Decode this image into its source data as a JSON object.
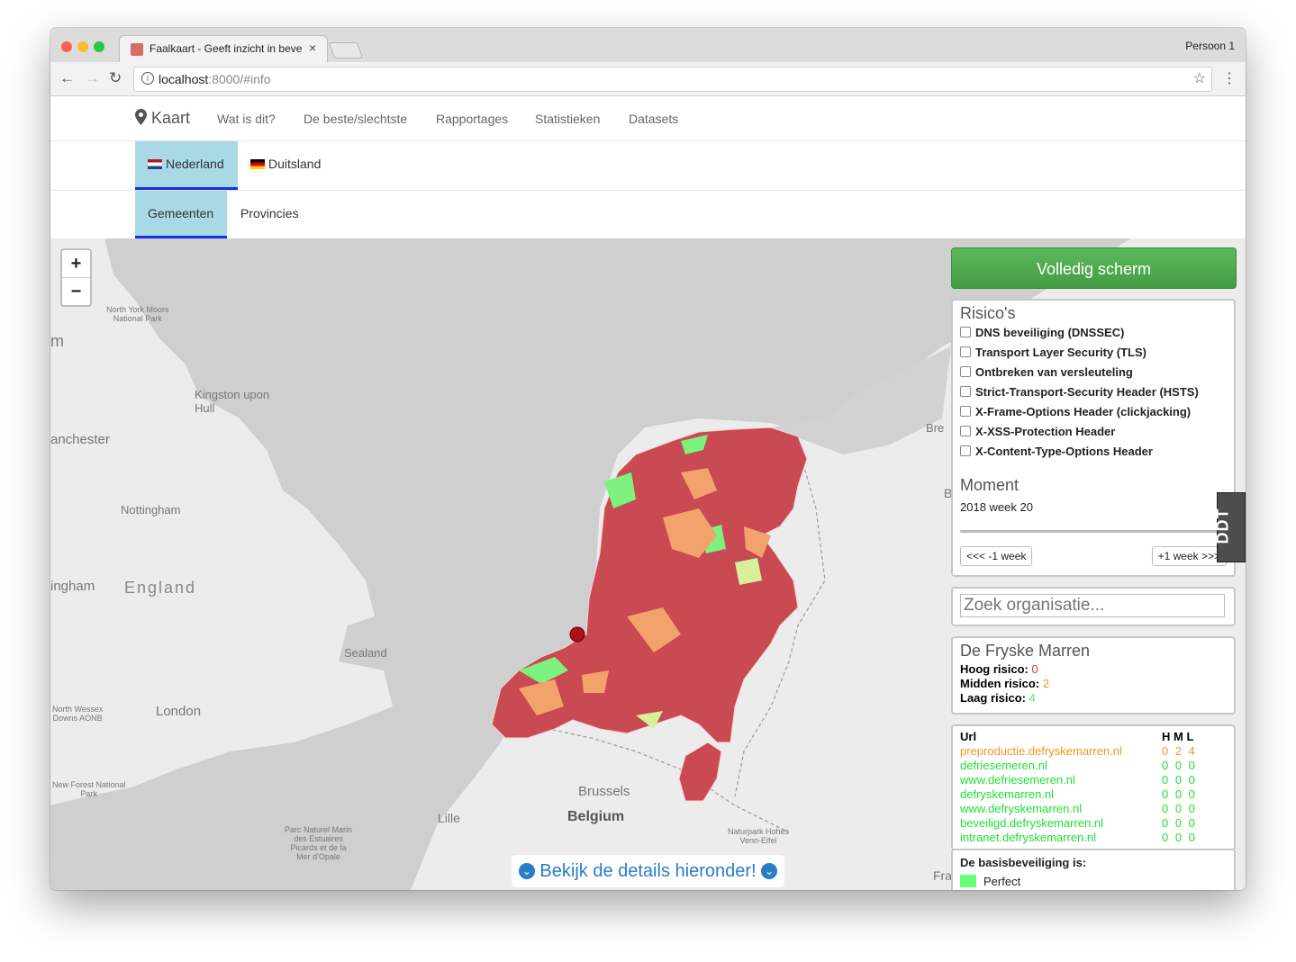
{
  "browser": {
    "tab_title": "Faalkaart - Geeft inzicht in beveiliging",
    "profile": "Persoon 1",
    "url_host": "localhost",
    "url_rest": ":8000/#info",
    "back": "←",
    "forward": "→",
    "reload": "↻",
    "info": "i",
    "star": "☆",
    "menu": "⋮",
    "close": "×"
  },
  "nav": {
    "brand": "Kaart",
    "links": [
      "Wat is dit?",
      "De beste/slechtste",
      "Rapportages",
      "Statistieken",
      "Datasets"
    ]
  },
  "countries": [
    "Nederland",
    "Duitsland"
  ],
  "layers": [
    "Gemeenten",
    "Provincies"
  ],
  "map": {
    "zoom_in": "+",
    "zoom_out": "−",
    "labels": {
      "north_york": "North York Moors\nNational Park",
      "kingston": "Kingston upon\nHull",
      "manchester": "anchester",
      "nottingham": "Nottingham",
      "birmingham": "ingham",
      "england": "England",
      "sealand": "Sealand",
      "london": "London",
      "wessex": "North Wessex\nDowns AONB",
      "new_forest": "New Forest National\nPark",
      "brussels": "Brussels",
      "belgium": "Belgium",
      "lille": "Lille",
      "parc_naturel": "Parc Naturel Marin\ndes Estuaires\nPicards et de la\nMer d'Opale",
      "naturpark": "Naturpark Hohes\nVenn-Eifel",
      "bremen": "Bre",
      "m": "m",
      "fra": "Fra",
      "b": "B"
    },
    "details_button": "Bekijk de details hieronder!",
    "chevron": "⌄"
  },
  "controls": {
    "fullscreen": "Volledig scherm",
    "risks_title": "Risico's",
    "risks": [
      "DNS beveiliging (DNSSEC)",
      "Transport Layer Security (TLS)",
      "Ontbreken van versleuteling",
      "Strict-Transport-Security Header (HSTS)",
      "X-Frame-Options Header (clickjacking)",
      "X-XSS-Protection Header",
      "X-Content-Type-Options Header"
    ],
    "moment_title": "Moment",
    "moment_value": "2018 week 20",
    "prev_week": "<<< -1 week",
    "next_week": "+1 week >>>",
    "search_placeholder": "Zoek organisatie...",
    "ddt": "DDT"
  },
  "organisation": {
    "name": "De Fryske Marren",
    "high_label": "Hoog risico:",
    "high": "0",
    "mid_label": "Midden risico:",
    "mid": "2",
    "low_label": "Laag risico:",
    "low": "4"
  },
  "url_table": {
    "col_url": "Url",
    "col_hml": "H M L",
    "rows": [
      {
        "url": "preproductie.defryskemarren.nl",
        "hml": "0 2 4",
        "color": "#f7941d"
      },
      {
        "url": "defriesemeren.nl",
        "hml": "0 0 0",
        "color": "#22dd33"
      },
      {
        "url": "www.defriesemeren.nl",
        "hml": "0 0 0",
        "color": "#22dd33"
      },
      {
        "url": "defryskemarren.nl",
        "hml": "0 0 0",
        "color": "#22dd33"
      },
      {
        "url": "www.defryskemarren.nl",
        "hml": "0 0 0",
        "color": "#22dd33"
      },
      {
        "url": "beveiligd.defryskemarren.nl",
        "hml": "0 0 0",
        "color": "#22dd33"
      },
      {
        "url": "intranet.defryskemarren.nl",
        "hml": "0 0 0",
        "color": "#22dd33"
      }
    ]
  },
  "legend": {
    "title": "De basisbeveiliging is:",
    "perfect": "Perfect",
    "perfect_color": "#66ff77"
  },
  "colors": {
    "high": "#c94a52",
    "mid": "#f4a26c",
    "low": "#7ef27e",
    "light": "#d8f09a",
    "accent_tab": "#a9d9e6",
    "tab_border": "#1330e8",
    "button_green": "#5cb85c"
  }
}
